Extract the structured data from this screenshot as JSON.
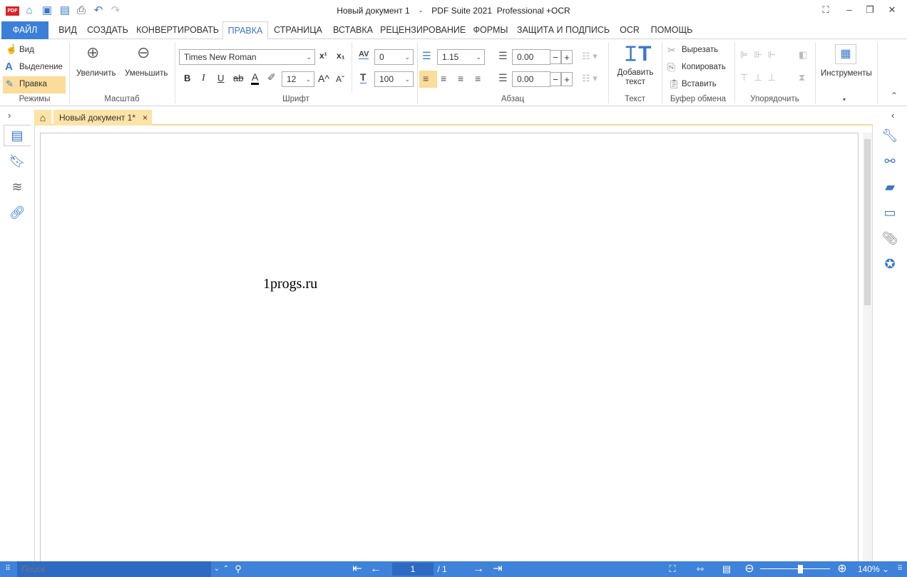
{
  "window": {
    "title": "Новый документ 1    -    PDF Suite 2021  Professional +OCR"
  },
  "quick_access": {
    "logo": "PDF",
    "icons": [
      "home-icon",
      "open-folder-icon",
      "save-icon",
      "print-icon",
      "undo-icon",
      "redo-icon"
    ]
  },
  "tabs": [
    {
      "label": "ФАЙЛ"
    },
    {
      "label": "ВИД"
    },
    {
      "label": "СОЗДАТЬ"
    },
    {
      "label": "КОНВЕРТИРОВАТЬ"
    },
    {
      "label": "ПРАВКА",
      "active": true
    },
    {
      "label": "СТРАНИЦА"
    },
    {
      "label": "ВСТАВКА"
    },
    {
      "label": "РЕЦЕНЗИРОВАНИЕ"
    },
    {
      "label": "ФОРМЫ"
    },
    {
      "label": "ЗАЩИТА И ПОДПИСЬ"
    },
    {
      "label": "OCR"
    },
    {
      "label": "ПОМОЩЬ"
    }
  ],
  "ribbon": {
    "modes": {
      "label": "Режимы",
      "items": [
        "Вид",
        "Выделение",
        "Правка"
      ],
      "selected": "Правка"
    },
    "zoom": {
      "label": "Масштаб",
      "zoom_in": "Увеличить",
      "zoom_out": "Уменьшить"
    },
    "font": {
      "label": "Шрифт",
      "family": "Times New Roman",
      "size": "12",
      "spacing": "0",
      "scale": "100",
      "superscript": "x¹",
      "subscript": "x₁",
      "bold": "B",
      "italic": "I",
      "underline": "U",
      "strike": "ab",
      "color": "A",
      "grow": "A^",
      "shrink": "Aˇ",
      "spacing_icon": "AV",
      "scale_icon": "T"
    },
    "paragraph": {
      "label": "Абзац",
      "line_spacing": "1.15",
      "indent_before": "0.00",
      "indent_after": "0.00",
      "selected_align": "left"
    },
    "text": {
      "label": "Текст",
      "add_text": "Добавить текст"
    },
    "clipboard": {
      "label": "Буфер обмена",
      "cut": "Вырезать",
      "copy": "Копировать",
      "paste": "Вставить"
    },
    "arrange": {
      "label": "Упорядочить"
    },
    "tools": {
      "label": "Инструменты"
    }
  },
  "document_tab": {
    "label": "Новый документ 1*",
    "close": "×"
  },
  "page": {
    "text": "1progs.ru"
  },
  "status": {
    "search_placeholder": "Поиск",
    "page_current": "1",
    "page_total": "/ 1",
    "zoom": "140%"
  },
  "colors": {
    "accent": "#3c7fd9",
    "tab_highlight": "#fde3a6"
  }
}
